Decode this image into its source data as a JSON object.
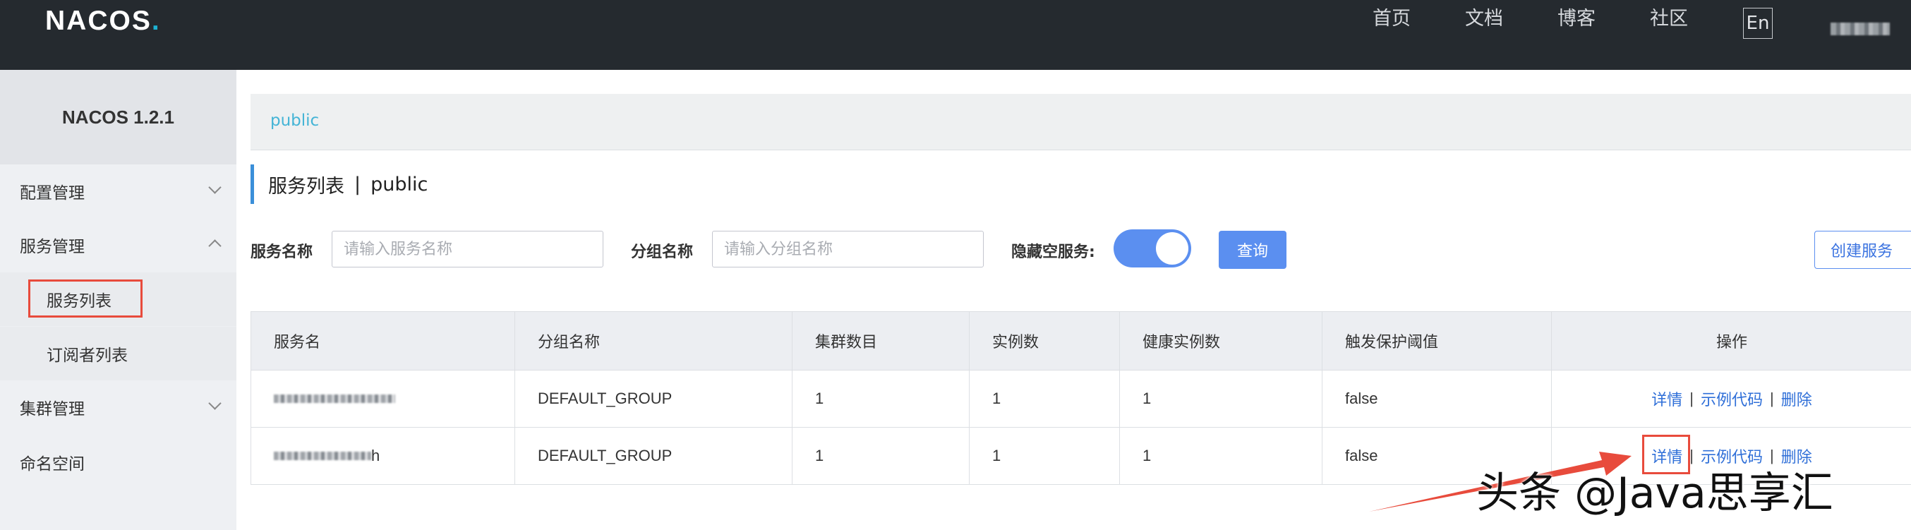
{
  "navbar": {
    "logo_text": "NACOS",
    "logo_dot": ".",
    "links": [
      "首页",
      "文档",
      "博客",
      "社区"
    ],
    "lang_button": "En"
  },
  "sidebar": {
    "title": "NACOS 1.2.1",
    "items": [
      {
        "label": "配置管理",
        "expanded": false
      },
      {
        "label": "服务管理",
        "expanded": true
      },
      {
        "label": "服务列表",
        "selected": true
      },
      {
        "label": "订阅者列表"
      },
      {
        "label": "集群管理",
        "expanded": false
      },
      {
        "label": "命名空间"
      }
    ]
  },
  "namespace": {
    "tag": "public"
  },
  "page": {
    "title": "服务列表",
    "separator": "|",
    "namespace": "public"
  },
  "filters": {
    "service_name_label": "服务名称",
    "service_name_placeholder": "请输入服务名称",
    "group_name_label": "分组名称",
    "group_name_placeholder": "请输入分组名称",
    "hide_empty_label": "隐藏空服务:",
    "hide_empty_on": true,
    "query_button": "查询",
    "create_button": "创建服务"
  },
  "table": {
    "columns": [
      "服务名",
      "分组名称",
      "集群数目",
      "实例数",
      "健康实例数",
      "触发保护阈值",
      "操作"
    ],
    "rows": [
      {
        "service_suffix": "",
        "group": "DEFAULT_GROUP",
        "clusters": "1",
        "instances": "1",
        "healthy": "1",
        "threshold": "false"
      },
      {
        "service_suffix": "h",
        "group": "DEFAULT_GROUP",
        "clusters": "1",
        "instances": "1",
        "healthy": "1",
        "threshold": "false"
      }
    ],
    "actions": {
      "detail": "详情",
      "sample": "示例代码",
      "delete": "删除",
      "separator": "|"
    }
  },
  "watermark": "头条 @Java思享汇",
  "colors": {
    "accent": "#5b8ff0",
    "link": "#2f6fd8",
    "topbar": "#252a2f",
    "annotation": "#e84b3c"
  }
}
